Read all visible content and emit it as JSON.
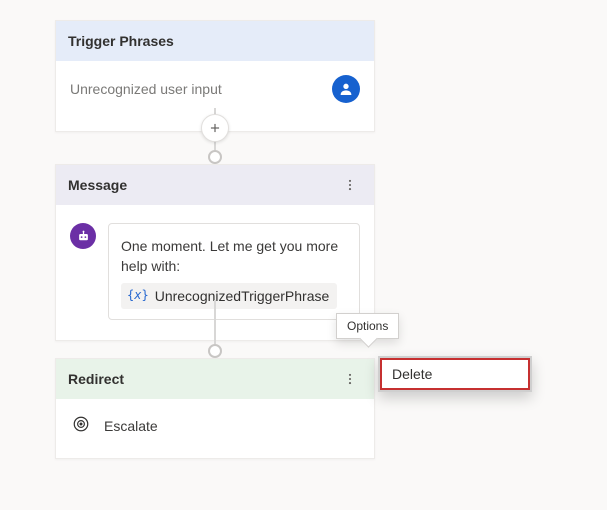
{
  "trigger": {
    "title": "Trigger Phrases",
    "phrase": "Unrecognized user input"
  },
  "message": {
    "title": "Message",
    "text": "One moment. Let me get you more help with:",
    "variable": "UnrecognizedTriggerPhrase"
  },
  "redirect": {
    "title": "Redirect",
    "target": "Escalate"
  },
  "tooltip": {
    "options": "Options"
  },
  "menu": {
    "delete": "Delete"
  },
  "icons": {
    "user": "user-icon",
    "bot": "bot-icon",
    "escalate": "escalate-icon",
    "plus": "plus-icon",
    "more": "more-vertical-icon"
  },
  "colors": {
    "accent_blue": "#1661cf",
    "bot_purple": "#6b2fa5",
    "danger": "#c63030",
    "trigger_header": "#e5ecf9",
    "message_header": "#ecebf3",
    "redirect_header": "#e8f3e9"
  }
}
